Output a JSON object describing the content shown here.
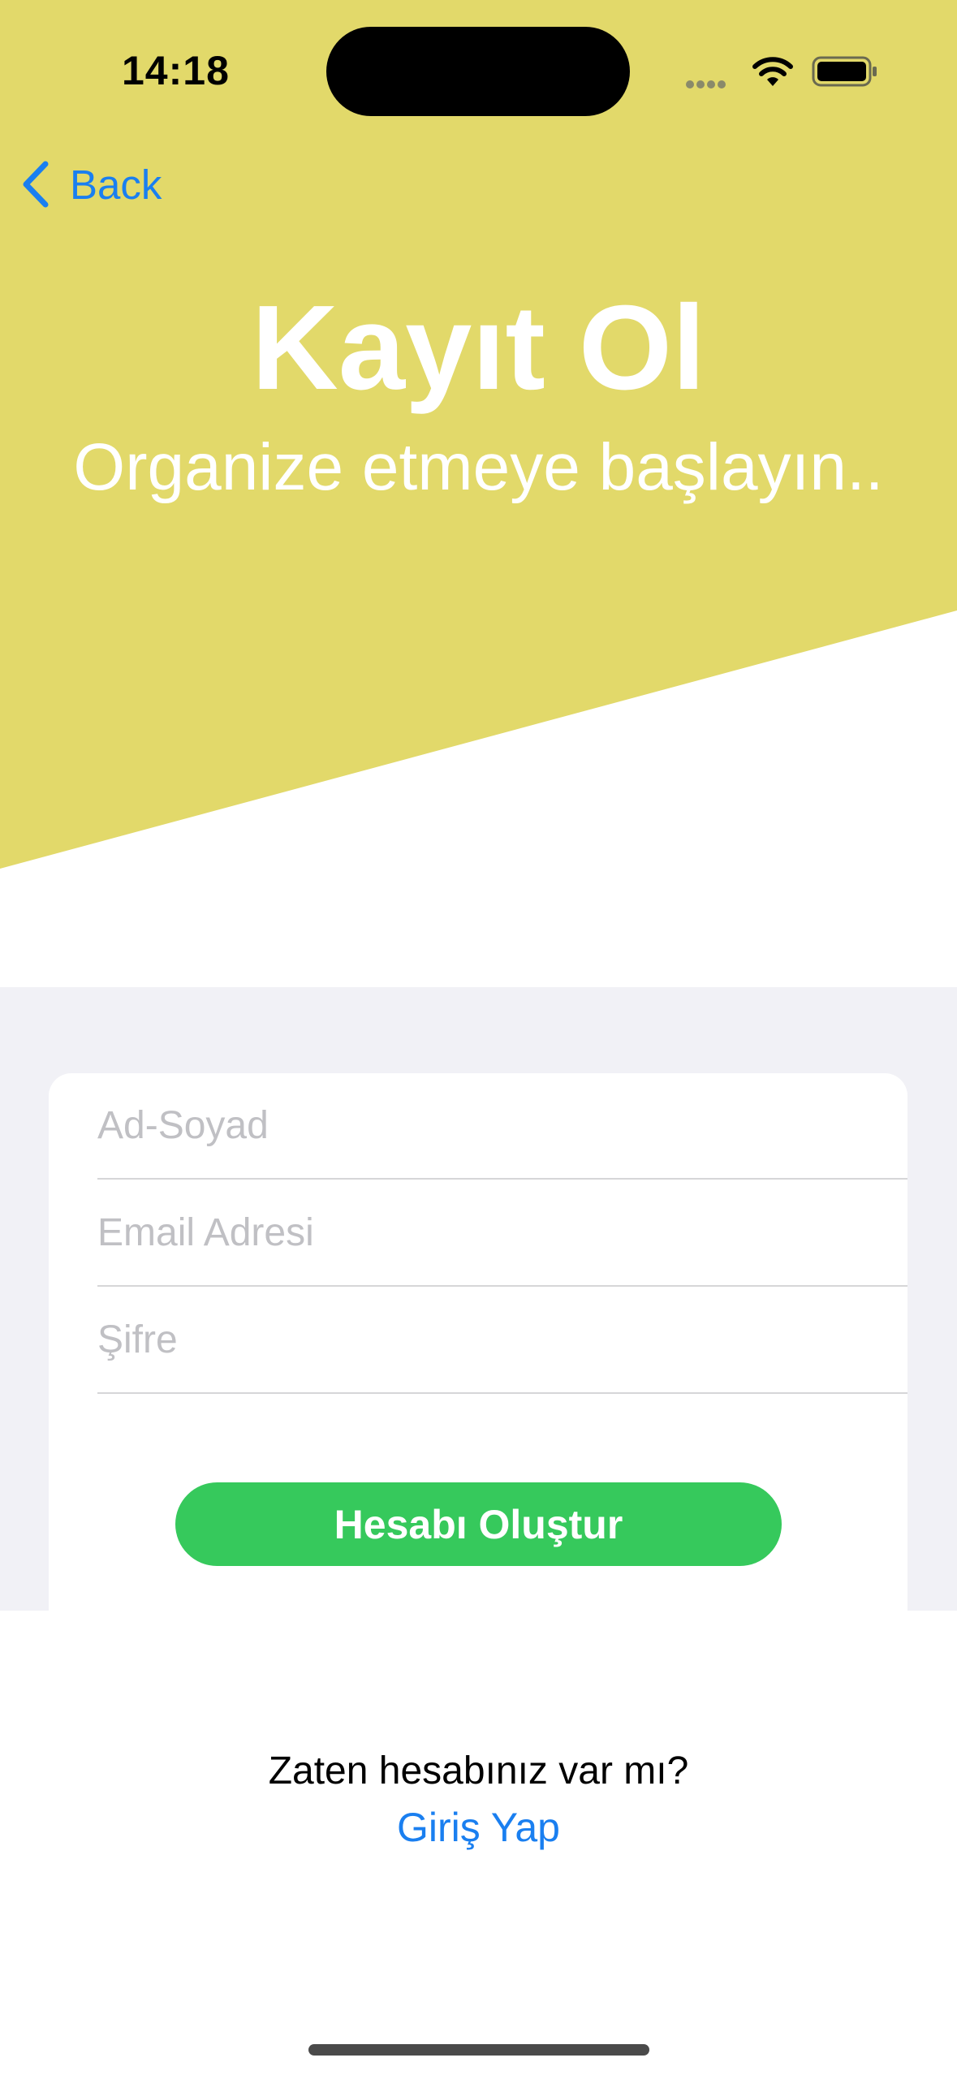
{
  "status_bar": {
    "time": "14:18"
  },
  "nav": {
    "back_label": "Back"
  },
  "header": {
    "title": "Kayıt Ol",
    "subtitle": "Organize etmeye başlayın.."
  },
  "form": {
    "name_placeholder": "Ad-Soyad",
    "name_value": "",
    "email_placeholder": "Email Adresi",
    "email_value": "",
    "password_placeholder": "Şifre",
    "password_value": "",
    "submit_label": "Hesabı Oluştur"
  },
  "footer": {
    "question": "Zaten hesabınız var mı?",
    "login_label": "Giriş Yap"
  },
  "colors": {
    "accent_yellow": "#e2d96a",
    "button_green": "#36c95c",
    "link_blue": "#1a7ff0",
    "form_background": "#f1f1f6"
  },
  "icons": {
    "back": "chevron-left-icon",
    "wifi": "wifi-icon",
    "battery": "battery-icon",
    "signal": "signal-dots-icon"
  }
}
